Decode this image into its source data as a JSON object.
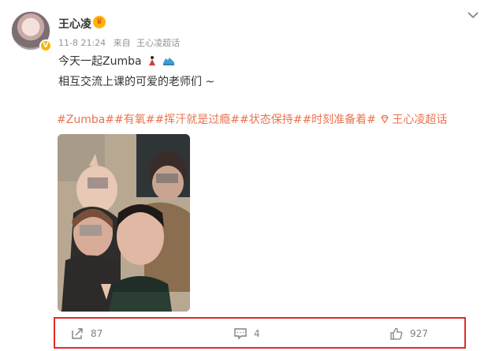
{
  "post": {
    "author": "王心凌",
    "timestamp": "11-8 21:24",
    "source_prefix": "来自",
    "source_name": "王心凌超话",
    "line1": "今天一起Zumba",
    "line2": "相互交流上课的可爱的老师们 ~",
    "hashtags": [
      "#Zumba#",
      "#有氧#",
      "#挥汗就是过瘾#",
      "#状态保持#",
      "#时刻准备着#"
    ],
    "supertopic": "王心凌超话"
  },
  "actions": {
    "forward_count": "87",
    "comment_count": "4",
    "like_count": "927"
  },
  "colors": {
    "link": "#eb7350",
    "highlight_border": "#e02b26",
    "verified": "#f7b500"
  },
  "icons": {
    "menu": "chevron-down-icon",
    "forward": "share-icon",
    "comment": "comment-icon",
    "like": "thumbs-up-icon"
  }
}
